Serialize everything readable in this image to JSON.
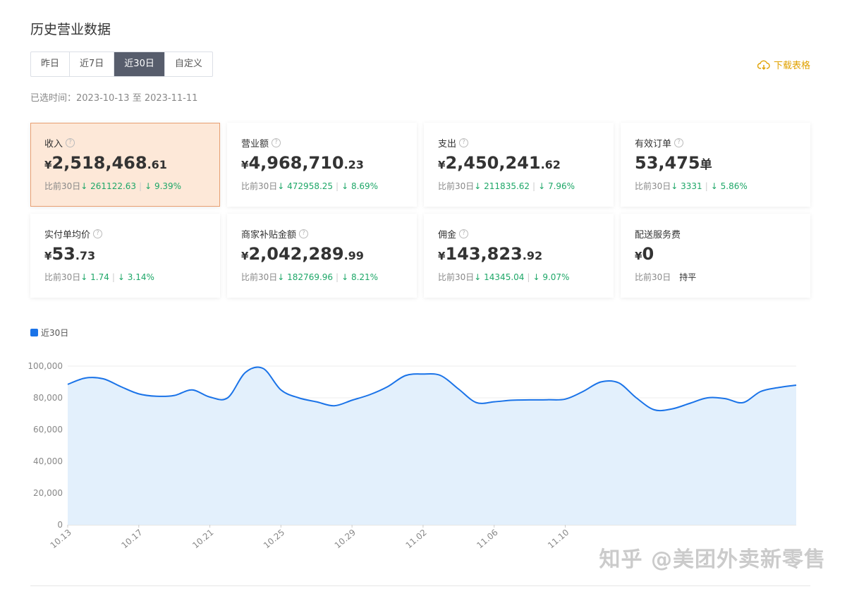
{
  "page": {
    "title": "历史营业数据"
  },
  "tabs": [
    {
      "label": "昨日",
      "active": false
    },
    {
      "label": "近7日",
      "active": false
    },
    {
      "label": "近30日",
      "active": true
    },
    {
      "label": "自定义",
      "active": false
    }
  ],
  "download": {
    "label": "下载表格",
    "icon": "cloud-download-icon",
    "color": "#e0a100"
  },
  "selected_time": {
    "label": "已选时间：",
    "range": "2023-10-13 至 2023-11-11"
  },
  "compare_label": "比前30日",
  "cards": [
    {
      "label": "收入",
      "help": true,
      "currency": "¥",
      "int": "2,518,468",
      "dec": ".61",
      "unit": "",
      "active": true,
      "diff": "↓ 261122.63",
      "pct": "↓ 9.39%",
      "flat": ""
    },
    {
      "label": "营业额",
      "help": true,
      "currency": "¥",
      "int": "4,968,710",
      "dec": ".23",
      "unit": "",
      "active": false,
      "diff": "↓ 472958.25",
      "pct": "↓ 8.69%",
      "flat": ""
    },
    {
      "label": "支出",
      "help": true,
      "currency": "¥",
      "int": "2,450,241",
      "dec": ".62",
      "unit": "",
      "active": false,
      "diff": "↓ 211835.62",
      "pct": "↓ 7.96%",
      "flat": ""
    },
    {
      "label": "有效订单",
      "help": true,
      "currency": "",
      "int": "53,475",
      "dec": "",
      "unit": "单",
      "active": false,
      "diff": "↓ 3331",
      "pct": "↓ 5.86%",
      "flat": ""
    },
    {
      "label": "实付单均价",
      "help": true,
      "currency": "¥",
      "int": "53",
      "dec": ".73",
      "unit": "",
      "active": false,
      "diff": "↓ 1.74",
      "pct": "↓ 3.14%",
      "flat": ""
    },
    {
      "label": "商家补贴金额",
      "help": true,
      "currency": "¥",
      "int": "2,042,289",
      "dec": ".99",
      "unit": "",
      "active": false,
      "diff": "↓ 182769.96",
      "pct": "↓ 8.21%",
      "flat": ""
    },
    {
      "label": "佣金",
      "help": true,
      "currency": "¥",
      "int": "143,823",
      "dec": ".92",
      "unit": "",
      "active": false,
      "diff": "↓ 14345.04",
      "pct": "↓ 9.07%",
      "flat": ""
    },
    {
      "label": "配送服务费",
      "help": false,
      "currency": "¥",
      "int": "0",
      "dec": "",
      "unit": "",
      "active": false,
      "diff": "",
      "pct": "",
      "flat": "持平"
    }
  ],
  "chart_data": {
    "type": "area",
    "series": [
      {
        "name": "近30日",
        "color": "#1a73e8",
        "fill": "#e3f0fc",
        "values": [
          88500,
          92500,
          92000,
          87000,
          82500,
          81000,
          81500,
          85000,
          80500,
          80000,
          96000,
          98500,
          85000,
          80000,
          77500,
          75000,
          78500,
          82000,
          87000,
          94000,
          95000,
          94000,
          85500,
          77000,
          77500,
          78500,
          78700,
          78800,
          79200,
          84000,
          90000,
          89500,
          80000,
          72500,
          73000,
          76500,
          80000,
          79500,
          77000,
          84000,
          86500,
          88000
        ]
      }
    ],
    "x_tick_labels": [
      "10.13",
      "10.17",
      "10.21",
      "10.25",
      "10.29",
      "11.02",
      "11.06",
      "11.10"
    ],
    "y_tick_labels": [
      "0",
      "20,000",
      "40,000",
      "60,000",
      "80,000",
      "100,000"
    ],
    "ylim": [
      0,
      100000
    ],
    "grid": true
  },
  "watermark": "知乎 @美团外卖新零售"
}
